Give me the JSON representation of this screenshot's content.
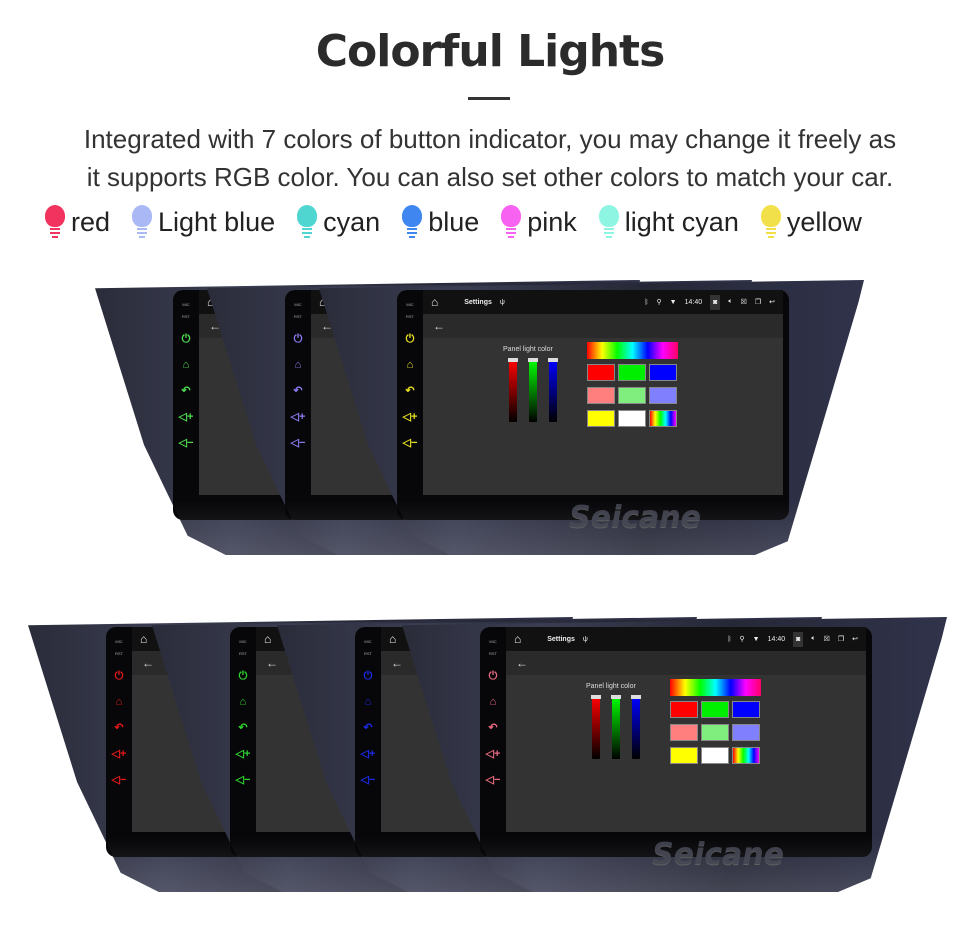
{
  "header": {
    "title": "Colorful Lights",
    "description_line1": "Integrated with 7 colors of button indicator, you may change it freely as",
    "description_line2": "it supports RGB color. You can also set other colors to match your car."
  },
  "legend": [
    {
      "label": "red",
      "color": "#f2335f"
    },
    {
      "label": "Light blue",
      "color": "#aab8f6"
    },
    {
      "label": "cyan",
      "color": "#4fd6d0"
    },
    {
      "label": "blue",
      "color": "#3f86f0"
    },
    {
      "label": "pink",
      "color": "#f763f0"
    },
    {
      "label": "light cyan",
      "color": "#8df5e2"
    },
    {
      "label": "yellow",
      "color": "#f2e04a"
    }
  ],
  "device": {
    "mic_label": "MIC",
    "rst_label": "RST",
    "app_title": "Settings",
    "time": "14:40",
    "panel_label": "Panel light color",
    "brand_watermark": "Seicane",
    "swatches": [
      "#ff0000",
      "#00ee00",
      "#0000ff",
      "#ff7f7f",
      "#7fee7f",
      "#8080ff",
      "#ffff00",
      "#ffffff",
      "rainbow"
    ]
  },
  "rows": [
    {
      "button_colors": [
        "#4fdc4f",
        "#8a7cf0",
        "#e8e020"
      ]
    },
    {
      "button_colors": [
        "#e81818",
        "#2ed22e",
        "#1a2ae8",
        "#e86a80"
      ]
    }
  ]
}
